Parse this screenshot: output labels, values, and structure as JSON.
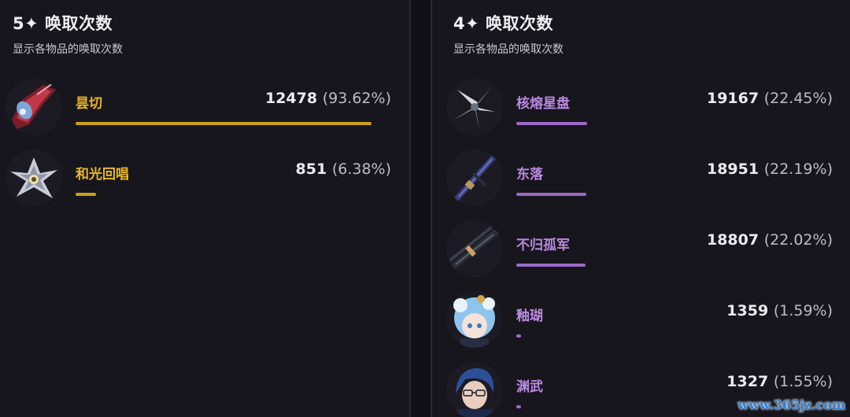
{
  "five_star": {
    "title": "5✦ 唤取次数",
    "subtitle": "显示各物品的唤取次数",
    "items": [
      {
        "name": "昙切",
        "count": "12478",
        "percent": "(93.62%)",
        "share": 0.9362,
        "icon": "red-blade-weapon-icon"
      },
      {
        "name": "和光回唱",
        "count": "851",
        "percent": "(6.38%)",
        "share": 0.0638,
        "icon": "silver-crystal-weapon-icon"
      }
    ]
  },
  "four_star": {
    "title": "4✦ 唤取次数",
    "subtitle": "显示各物品的唤取次数",
    "items": [
      {
        "name": "核熔星盘",
        "count": "19167",
        "percent": "(22.45%)",
        "share": 0.2245,
        "icon": "star-disc-weapon-icon"
      },
      {
        "name": "东落",
        "count": "18951",
        "percent": "(22.19%)",
        "share": 0.2219,
        "icon": "blue-sword-weapon-icon"
      },
      {
        "name": "不归孤军",
        "count": "18807",
        "percent": "(22.02%)",
        "share": 0.2202,
        "icon": "dark-sword-weapon-icon"
      },
      {
        "name": "釉瑚",
        "count": "1359",
        "percent": "(1.59%)",
        "share": 0.0159,
        "icon": "blue-hair-character-avatar"
      },
      {
        "name": "渊武",
        "count": "1327",
        "percent": "(1.55%)",
        "share": 0.0155,
        "icon": "glasses-character-avatar"
      }
    ]
  },
  "colors": {
    "five_star": "#e9b824",
    "four_star": "#b98ae0",
    "background": "#17161d"
  },
  "watermark": "www.365jz.com"
}
